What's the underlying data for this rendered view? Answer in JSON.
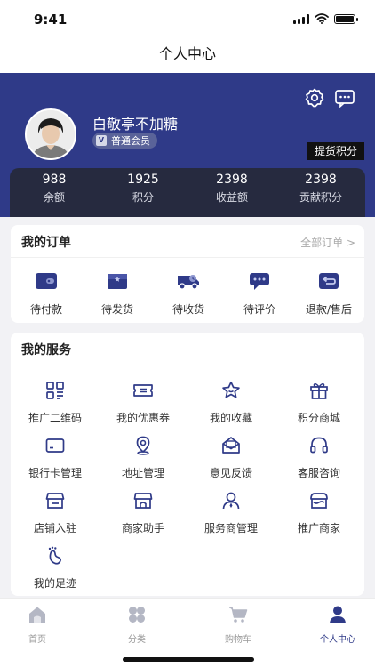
{
  "status_bar": {
    "time": "9:41"
  },
  "nav": {
    "title": "个人中心"
  },
  "profile": {
    "username": "白敬亭不加糖",
    "member_level": "普通会员",
    "member_badge_letter": "V",
    "pickup_points_button": "提货积分"
  },
  "stats": [
    {
      "value": "988",
      "label": "余额"
    },
    {
      "value": "1925",
      "label": "积分"
    },
    {
      "value": "2398",
      "label": "收益额"
    },
    {
      "value": "2398",
      "label": "贡献积分"
    }
  ],
  "orders": {
    "title": "我的订单",
    "view_all": "全部订单 >",
    "items": [
      {
        "label": "待付款",
        "icon": "wallet-icon"
      },
      {
        "label": "待发货",
        "icon": "box-icon"
      },
      {
        "label": "待收货",
        "icon": "truck-icon"
      },
      {
        "label": "待评价",
        "icon": "comment-icon"
      },
      {
        "label": "退款/售后",
        "icon": "refund-icon"
      }
    ]
  },
  "services": {
    "title": "我的服务",
    "items": [
      {
        "label": "推广二维码",
        "icon": "qrcode-icon"
      },
      {
        "label": "我的优惠券",
        "icon": "coupon-icon"
      },
      {
        "label": "我的收藏",
        "icon": "star-icon"
      },
      {
        "label": "积分商城",
        "icon": "gift-icon"
      },
      {
        "label": "银行卡管理",
        "icon": "bank-card-icon"
      },
      {
        "label": "地址管理",
        "icon": "location-icon"
      },
      {
        "label": "意见反馈",
        "icon": "feedback-icon"
      },
      {
        "label": "客服咨询",
        "icon": "headset-icon"
      },
      {
        "label": "店铺入驻",
        "icon": "store-icon"
      },
      {
        "label": "商家助手",
        "icon": "merchant-icon"
      },
      {
        "label": "服务商管理",
        "icon": "user-manage-icon"
      },
      {
        "label": "推广商家",
        "icon": "promote-store-icon"
      },
      {
        "label": "我的足迹",
        "icon": "footprint-icon"
      }
    ]
  },
  "tabbar": [
    {
      "label": "首页",
      "icon": "home-icon",
      "active": false
    },
    {
      "label": "分类",
      "icon": "category-icon",
      "active": false
    },
    {
      "label": "购物车",
      "icon": "cart-icon",
      "active": false
    },
    {
      "label": "个人中心",
      "icon": "person-icon",
      "active": true
    }
  ],
  "colors": {
    "primary": "#2f3a88",
    "stats_bg": "#262a3f",
    "page_bg": "#f2f2f5"
  }
}
